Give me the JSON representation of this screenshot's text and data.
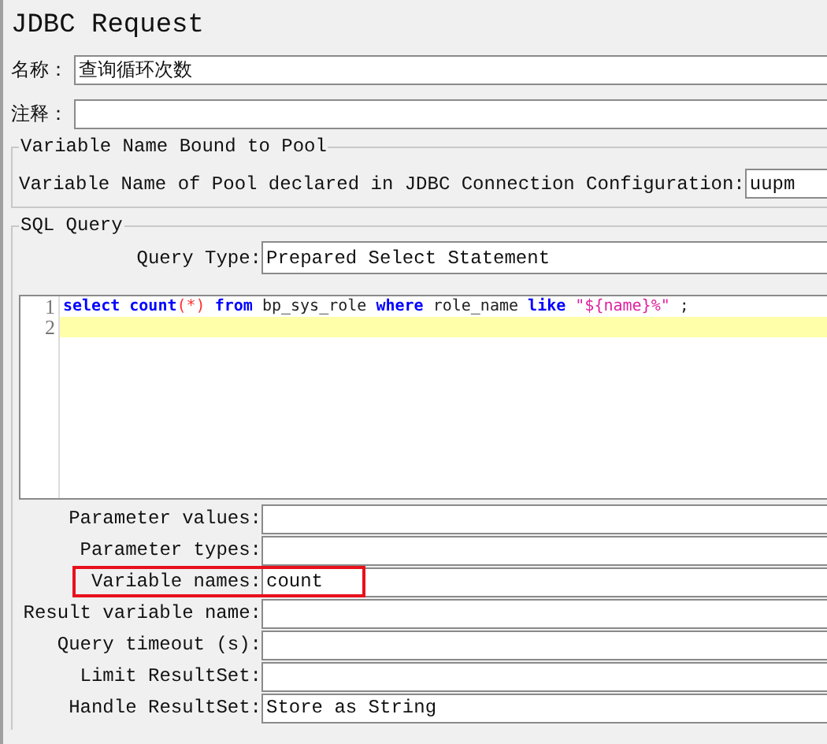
{
  "title": "JDBC Request",
  "name_field": {
    "label": "名称：",
    "value": "查询循环次数"
  },
  "comment_field": {
    "label": "注释："
  },
  "pool_section": {
    "legend": "Variable Name Bound to Pool",
    "label": "Variable Name of Pool declared in JDBC Connection Configuration:",
    "value": "uupm"
  },
  "sql_section": {
    "legend": "SQL Query",
    "query_type": {
      "label": "Query Type:",
      "value": "Prepared Select Statement"
    },
    "editor": {
      "lines": [
        {
          "number": "1",
          "current": false,
          "tokens": [
            {
              "kind": "keyword",
              "text": "select"
            },
            {
              "kind": "keyword",
              "text": " count"
            },
            {
              "kind": "operator",
              "text": "(*)"
            },
            {
              "kind": "keyword",
              "text": " from"
            },
            {
              "kind": "plain",
              "text": " bp_sys_role "
            },
            {
              "kind": "keyword",
              "text": "where"
            },
            {
              "kind": "plain",
              "text": " role_name "
            },
            {
              "kind": "keyword",
              "text": "like"
            },
            {
              "kind": "string",
              "text": " \"${name}%\""
            },
            {
              "kind": "plain",
              "text": " ;"
            }
          ]
        },
        {
          "number": "2",
          "current": true
        }
      ]
    },
    "params": [
      {
        "label": "Parameter values:",
        "highlighted": false
      },
      {
        "label": "Parameter types:",
        "highlighted": false
      },
      {
        "label": "Variable names:",
        "value": "count",
        "highlighted": true
      },
      {
        "label": "Result variable name:",
        "highlighted": false
      },
      {
        "label": "Query timeout (s):",
        "highlighted": false
      },
      {
        "label": "Limit ResultSet:",
        "highlighted": false
      },
      {
        "label": "Handle ResultSet:",
        "value": "Store as String",
        "highlighted": false
      }
    ]
  }
}
